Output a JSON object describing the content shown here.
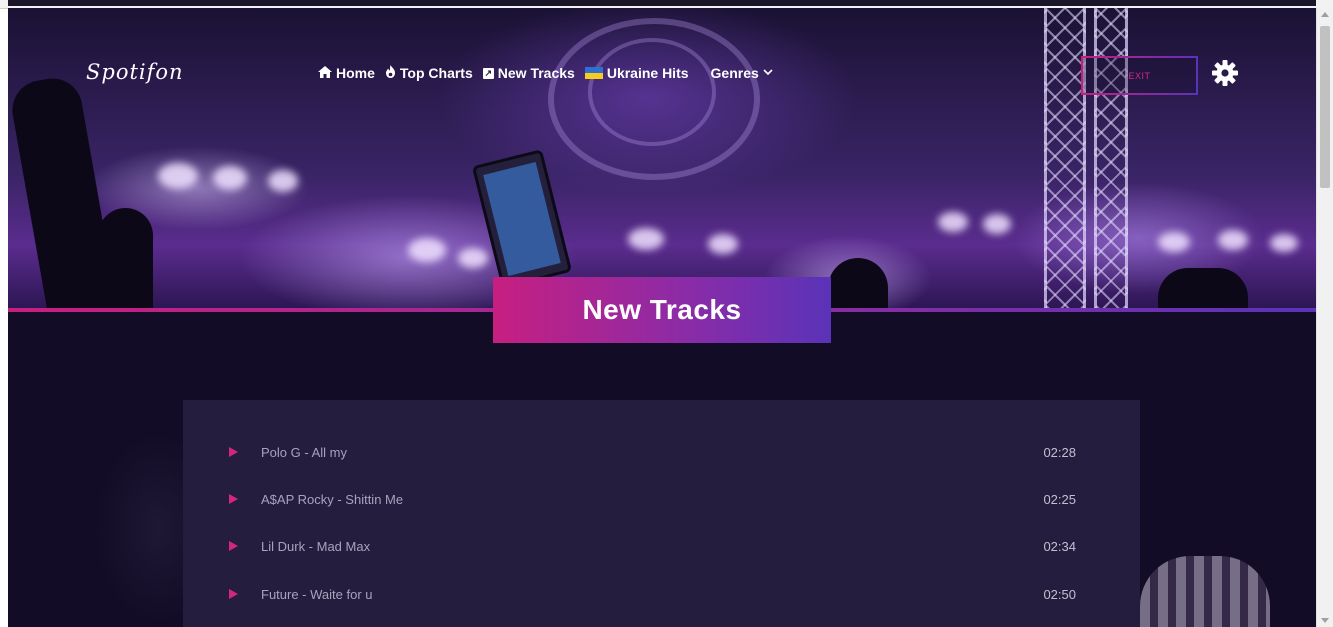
{
  "app": {
    "logo": "Spotifon"
  },
  "nav": {
    "items": [
      {
        "label": "Home",
        "icon": "home-icon"
      },
      {
        "label": "Top Charts",
        "icon": "fire-icon"
      },
      {
        "label": "New Tracks",
        "icon": "new-arrow-icon"
      },
      {
        "label": "Ukraine Hits",
        "icon": "ukraine-flag-icon"
      },
      {
        "label": "Genres",
        "icon": "chevron-down-icon"
      }
    ],
    "exit_label": "EXIT",
    "settings_icon": "gear-icon"
  },
  "section": {
    "title": "New Tracks"
  },
  "tracks": [
    {
      "title": "Polo G - All my",
      "duration": "02:28"
    },
    {
      "title": "A$AP Rocky - Shittin Me",
      "duration": "02:25"
    },
    {
      "title": "Lil Durk - Mad Max",
      "duration": "02:34"
    },
    {
      "title": "Future - Waite for u",
      "duration": "02:50"
    }
  ],
  "colors": {
    "accent_pink": "#c71f80",
    "accent_purple": "#5a33b8",
    "panel": "#251d3d",
    "page_bg": "#120c26"
  }
}
